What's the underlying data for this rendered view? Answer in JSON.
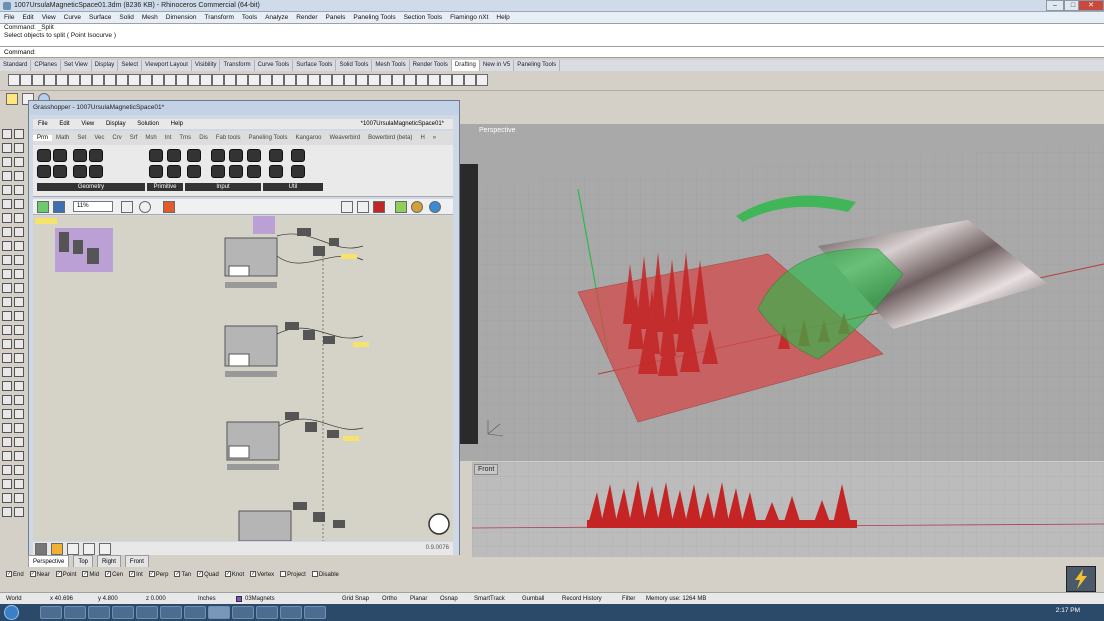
{
  "window": {
    "title": "1007UrsulaMagneticSpace01.3dm (8236 KB) - Rhinoceros Commercial (64-bit)",
    "controls": [
      "–",
      "□",
      "✕"
    ]
  },
  "menubar": [
    "File",
    "Edit",
    "View",
    "Curve",
    "Surface",
    "Solid",
    "Mesh",
    "Dimension",
    "Transform",
    "Tools",
    "Analyze",
    "Render",
    "Panels",
    "Paneling Tools",
    "Section Tools",
    "Flamingo nXt",
    "Help"
  ],
  "command": {
    "history": [
      "Command: _Split",
      "Select objects to split ( Point Isocurve )"
    ],
    "prompt": "Command:"
  },
  "toolbar_tabs": {
    "items": [
      "Standard",
      "CPlanes",
      "Set View",
      "Display",
      "Select",
      "Viewport Layout",
      "Visibility",
      "Transform",
      "Curve Tools",
      "Surface Tools",
      "Solid Tools",
      "Mesh Tools",
      "Render Tools",
      "Drafting",
      "New in V5",
      "Paneling Tools"
    ],
    "active": "Drafting"
  },
  "grasshopper": {
    "title": "Grasshopper - 1007UrsulaMagneticSpace01*",
    "menu": [
      "File",
      "Edit",
      "View",
      "Display",
      "Solution",
      "Help"
    ],
    "doc_name": "*1007UrsulaMagneticSpace01*",
    "tabs": [
      "Prm",
      "Math",
      "Set",
      "Vec",
      "Crv",
      "Srf",
      "Msh",
      "Int",
      "Trns",
      "Dis",
      "Fab tools",
      "Paneling Tools",
      "Kangaroo",
      "Weaverbird",
      "Bowerbird (beta)",
      "H",
      "»"
    ],
    "active_tab": "Prm",
    "groups": [
      "Geometry",
      "Primitive",
      "Input",
      "Util"
    ],
    "zoom": "11%",
    "version": "0.9.0076"
  },
  "viewports": {
    "perspective_label": "Perspective",
    "front_label": "Front",
    "tabs": [
      "Perspective",
      "Top",
      "Right",
      "Front"
    ]
  },
  "osnap": {
    "items": [
      {
        "label": "End",
        "checked": true
      },
      {
        "label": "Near",
        "checked": true
      },
      {
        "label": "Point",
        "checked": true
      },
      {
        "label": "Mid",
        "checked": true
      },
      {
        "label": "Cen",
        "checked": true
      },
      {
        "label": "Int",
        "checked": true
      },
      {
        "label": "Perp",
        "checked": true
      },
      {
        "label": "Tan",
        "checked": true
      },
      {
        "label": "Quad",
        "checked": true
      },
      {
        "label": "Knot",
        "checked": true
      },
      {
        "label": "Vertex",
        "checked": true
      },
      {
        "label": "Project",
        "checked": false
      },
      {
        "label": "Disable",
        "checked": false
      }
    ]
  },
  "status": {
    "cplane": "World",
    "x": "x 40.696",
    "y": "y 4.800",
    "z": "z 0.000",
    "units": "Inches",
    "layer": "03Magnets",
    "grid_snap": "Grid Snap",
    "ortho": "Ortho",
    "planar": "Planar",
    "osnap": "Osnap",
    "smarttrack": "SmartTrack",
    "gumball": "Gumball",
    "record_history": "Record History",
    "filter": "Filter",
    "memory": "Memory use: 1264 MB"
  },
  "taskbar": {
    "time": "2:17 PM"
  },
  "colors": {
    "surface_red": "#d34a4a",
    "surface_green": "#2fb84a",
    "viewport_bg": "#a7a7a7",
    "grasshopper_canvas": "#d5d2c8"
  }
}
